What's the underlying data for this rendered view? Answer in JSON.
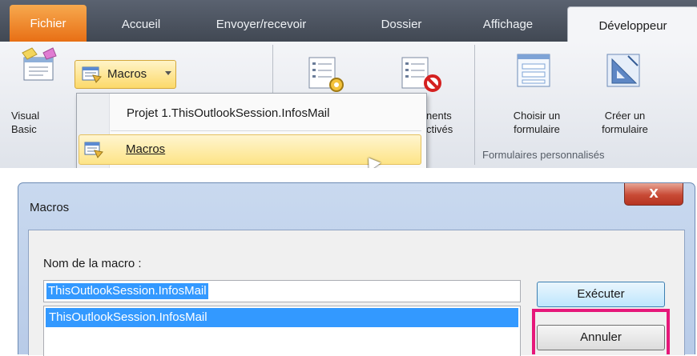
{
  "ribbon": {
    "tabs": [
      {
        "label": "Fichier"
      },
      {
        "label": "Accueil"
      },
      {
        "label": "Envoyer/recevoir"
      },
      {
        "label": "Dossier"
      },
      {
        "label": "Affichage"
      },
      {
        "label": "Développeur"
      }
    ],
    "active_tab": "Développeur",
    "visual_basic": {
      "line1": "Visual",
      "line2": "Basic"
    },
    "macros_button": {
      "label": "Macros"
    },
    "dropdown": {
      "item1": "Projet 1.ThisOutlookSession.InfosMail",
      "item2": "Macros"
    },
    "partial_button": {
      "line1": "nents",
      "line2": "ctivés"
    },
    "forms": {
      "choose_line1": "Choisir un",
      "choose_line2": "formulaire",
      "create_line1": "Créer un",
      "create_line2": "formulaire",
      "group_label": "Formulaires personnalisés"
    },
    "colors": {
      "file_tab": "#e86f15",
      "hover": "#fde487"
    }
  },
  "dialog": {
    "title": "Macros",
    "close_label": "X",
    "field_label": "Nom de la macro :",
    "input_value": "ThisOutlookSession.InfosMail",
    "list_items": [
      "ThisOutlookSession.InfosMail"
    ],
    "buttons": {
      "execute": "Exécuter",
      "cancel": "Annuler"
    },
    "highlight_color": "#e6187a"
  }
}
